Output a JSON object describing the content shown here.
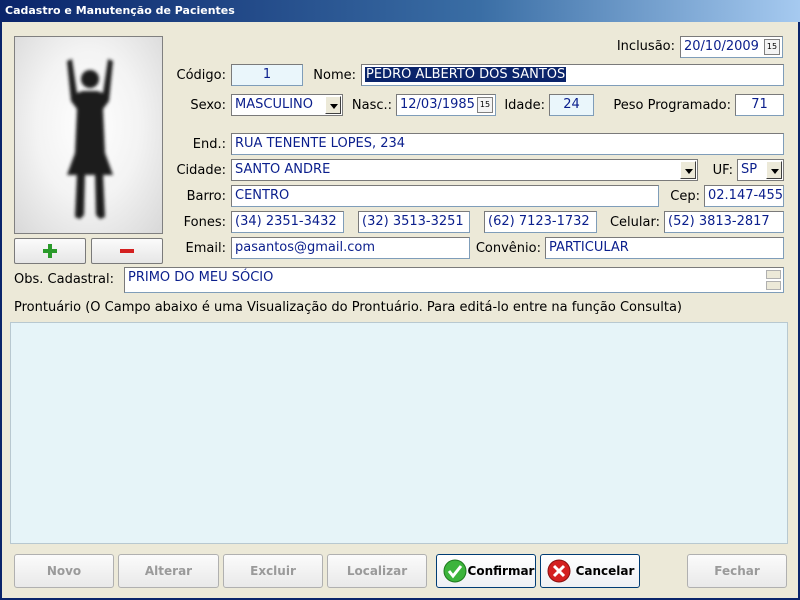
{
  "window": {
    "title": "Cadastro e Manutenção de Pacientes"
  },
  "labels": {
    "inclusao": "Inclusão:",
    "codigo": "Código:",
    "nome": "Nome:",
    "sexo": "Sexo:",
    "nasc": "Nasc.:",
    "idade": "Idade:",
    "peso": "Peso Programado:",
    "end": "End.:",
    "cidade": "Cidade:",
    "uf": "UF:",
    "barro": "Barro:",
    "cep": "Cep:",
    "fones": "Fones:",
    "celular": "Celular:",
    "email": "Email:",
    "convenio": "Convênio:",
    "obs": "Obs. Cadastral:",
    "prontuario": "Prontuário (O Campo abaixo é uma Visualização do Prontuário. Para editá-lo entre na função Consulta)"
  },
  "fields": {
    "inclusao": "20/10/2009",
    "codigo": "1",
    "nome": "PEDRO ALBERTO DOS SANTOS",
    "sexo": "MASCULINO",
    "nasc": "12/03/1985",
    "idade": "24",
    "peso": "71",
    "end": "RUA TENENTE LOPES, 234",
    "cidade": "SANTO ANDRE",
    "uf": "SP",
    "barro": "CENTRO",
    "cep": "02.147-455",
    "fone1": "(34) 2351-3432",
    "fone2": "(32) 3513-3251",
    "fone3": "(62) 7123-1732",
    "celular": "(52) 3813-2817",
    "email": "pasantos@gmail.com",
    "convenio": "PARTICULAR",
    "obs": "PRIMO DO MEU SÓCIO",
    "prontuario": ""
  },
  "photo": {
    "add_icon": "plus-icon",
    "remove_icon": "minus-icon"
  },
  "buttons": {
    "novo": "Novo",
    "alterar": "Alterar",
    "excluir": "Excluir",
    "localizar": "Localizar",
    "confirmar": "Confirmar",
    "cancelar": "Cancelar",
    "fechar": "Fechar"
  },
  "colors": {
    "title_bar": "#0a246a",
    "field_text": "#0a1e8c",
    "prontuario_bg": "#e6f4f8",
    "confirm_icon": "#3cb43c",
    "cancel_icon": "#d42020"
  }
}
